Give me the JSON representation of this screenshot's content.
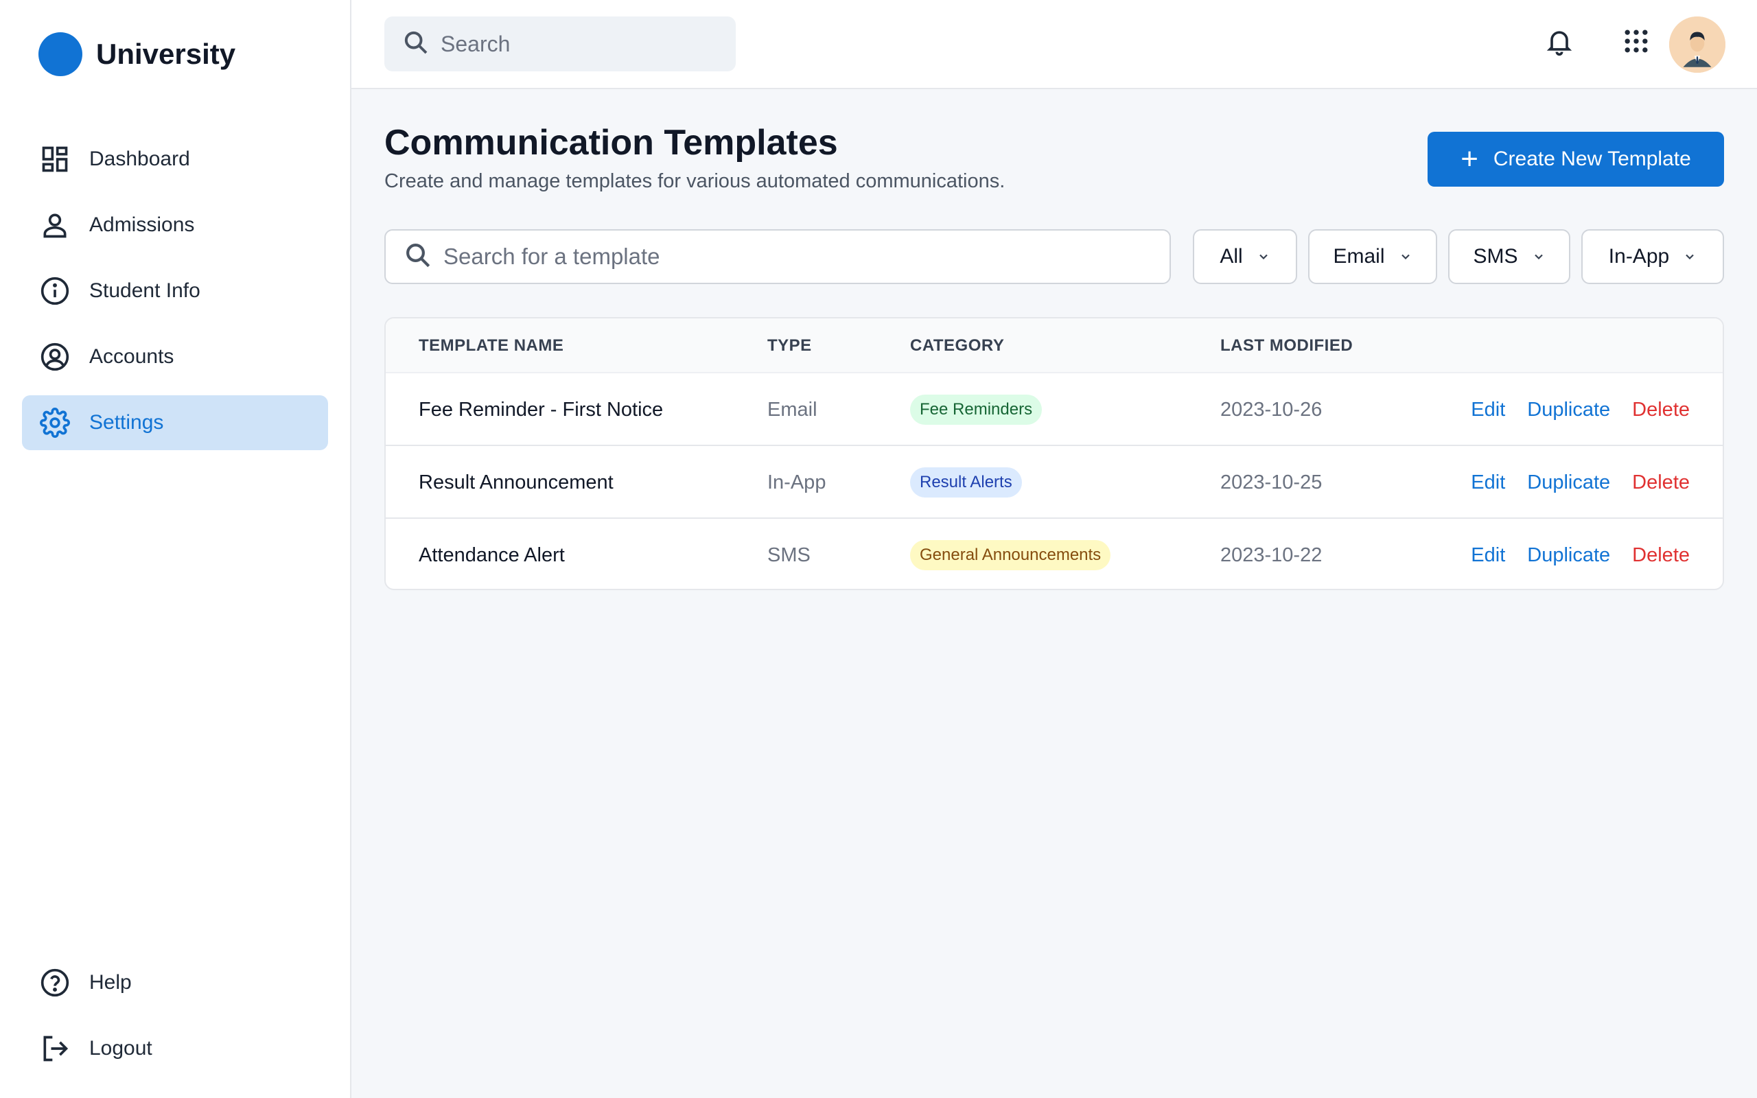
{
  "brand": {
    "name": "University"
  },
  "sidebar": {
    "items": [
      {
        "label": "Dashboard",
        "icon": "dashboard-icon"
      },
      {
        "label": "Admissions",
        "icon": "person-icon"
      },
      {
        "label": "Student Info",
        "icon": "info-icon"
      },
      {
        "label": "Accounts",
        "icon": "account-circle-icon"
      },
      {
        "label": "Settings",
        "icon": "gear-icon",
        "active": true
      }
    ],
    "bottom": [
      {
        "label": "Help",
        "icon": "help-icon"
      },
      {
        "label": "Logout",
        "icon": "logout-icon"
      }
    ]
  },
  "header": {
    "search_placeholder": "Search",
    "icons": [
      "bell-icon",
      "apps-grid-icon",
      "avatar"
    ]
  },
  "page": {
    "title": "Communication Templates",
    "subtitle": "Create and manage templates for various automated communications.",
    "create_button": "Create New Template"
  },
  "filters": {
    "search_placeholder": "Search for a template",
    "dropdowns": [
      "All",
      "Email",
      "SMS",
      "In-App"
    ]
  },
  "table": {
    "columns": [
      "TEMPLATE NAME",
      "TYPE",
      "CATEGORY",
      "LAST MODIFIED"
    ],
    "rows": [
      {
        "name": "Fee Reminder - First Notice",
        "type": "Email",
        "category": "Fee Reminders",
        "modified": "2023-10-26"
      },
      {
        "name": "Result Announcement",
        "type": "In-App",
        "category": "Result Alerts",
        "modified": "2023-10-25"
      },
      {
        "name": "Attendance Alert",
        "type": "SMS",
        "category": "General Announcements",
        "modified": "2023-10-22"
      }
    ],
    "actions": {
      "edit": "Edit",
      "duplicate": "Duplicate",
      "delete": "Delete"
    }
  },
  "colors": {
    "accent": "#1173d4",
    "active_nav_bg": "#cfe3f8",
    "delete": "#e03131",
    "badge_green_bg": "#dcfce7",
    "badge_green_fg": "#166534",
    "badge_blue_bg": "#dbeafe",
    "badge_blue_fg": "#1e40af",
    "badge_yellow_bg": "#fef9c3",
    "badge_yellow_fg": "#854d0e"
  }
}
